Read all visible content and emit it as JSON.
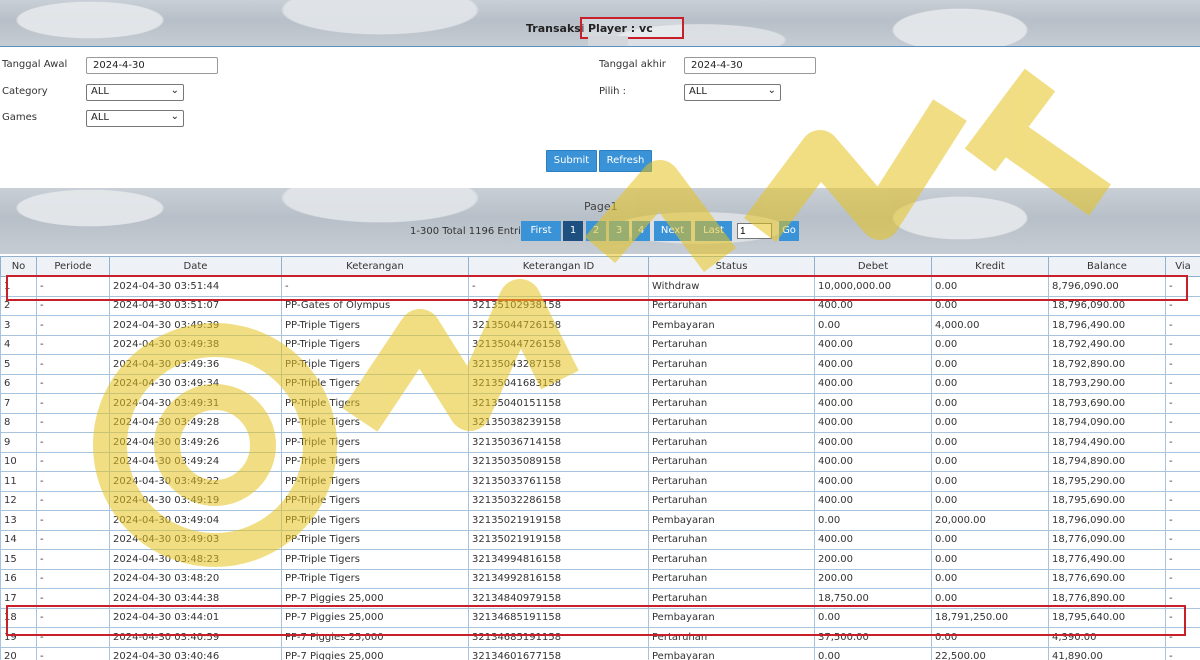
{
  "header": {
    "title": "Transaksi",
    "player_label": "Player : vc"
  },
  "filters": {
    "start_label": "Tanggal Awal",
    "start_value": "2024-4-30",
    "end_label": "Tanggal akhir",
    "end_value": "2024-4-30",
    "category_label": "Category",
    "category_value": "ALL",
    "pilih_label": "Pilih  :",
    "pilih_value": "ALL",
    "games_label": "Games",
    "games_value": "ALL",
    "submit": "Submit",
    "refresh": "Refresh"
  },
  "pagination": {
    "page_label": "Page1",
    "total": "1-300 Total 1196 Entri",
    "first": "First",
    "p1": "1",
    "p2": "2",
    "p3": "3",
    "p4": "4",
    "next": "Next",
    "last": "Last",
    "input_value": "1",
    "go": "Go"
  },
  "table": {
    "columns": [
      "No",
      "Periode",
      "Date",
      "Keterangan",
      "Keterangan ID",
      "Status",
      "Debet",
      "Kredit",
      "Balance",
      "Via"
    ],
    "rows": [
      [
        "1",
        "-",
        "2024-04-30 03:51:44",
        "-",
        "-",
        "Withdraw",
        "10,000,000.00",
        "0.00",
        "8,796,090.00",
        "-"
      ],
      [
        "2",
        "-",
        "2024-04-30 03:51:07",
        "PP-Gates of Olympus",
        "32135102938158",
        "Pertaruhan",
        "400.00",
        "0.00",
        "18,796,090.00",
        "-"
      ],
      [
        "3",
        "-",
        "2024-04-30 03:49:39",
        "PP-Triple Tigers",
        "32135044726158",
        "Pembayaran",
        "0.00",
        "4,000.00",
        "18,796,490.00",
        "-"
      ],
      [
        "4",
        "-",
        "2024-04-30 03:49:38",
        "PP-Triple Tigers",
        "32135044726158",
        "Pertaruhan",
        "400.00",
        "0.00",
        "18,792,490.00",
        "-"
      ],
      [
        "5",
        "-",
        "2024-04-30 03:49:36",
        "PP-Triple Tigers",
        "32135043287158",
        "Pertaruhan",
        "400.00",
        "0.00",
        "18,792,890.00",
        "-"
      ],
      [
        "6",
        "-",
        "2024-04-30 03:49:34",
        "PP-Triple Tigers",
        "32135041683158",
        "Pertaruhan",
        "400.00",
        "0.00",
        "18,793,290.00",
        "-"
      ],
      [
        "7",
        "-",
        "2024-04-30 03:49:31",
        "PP-Triple Tigers",
        "32135040151158",
        "Pertaruhan",
        "400.00",
        "0.00",
        "18,793,690.00",
        "-"
      ],
      [
        "8",
        "-",
        "2024-04-30 03:49:28",
        "PP-Triple Tigers",
        "32135038239158",
        "Pertaruhan",
        "400.00",
        "0.00",
        "18,794,090.00",
        "-"
      ],
      [
        "9",
        "-",
        "2024-04-30 03:49:26",
        "PP-Triple Tigers",
        "32135036714158",
        "Pertaruhan",
        "400.00",
        "0.00",
        "18,794,490.00",
        "-"
      ],
      [
        "10",
        "-",
        "2024-04-30 03:49:24",
        "PP-Triple Tigers",
        "32135035089158",
        "Pertaruhan",
        "400.00",
        "0.00",
        "18,794,890.00",
        "-"
      ],
      [
        "11",
        "-",
        "2024-04-30 03:49:22",
        "PP-Triple Tigers",
        "32135033761158",
        "Pertaruhan",
        "400.00",
        "0.00",
        "18,795,290.00",
        "-"
      ],
      [
        "12",
        "-",
        "2024-04-30 03:49:19",
        "PP-Triple Tigers",
        "32135032286158",
        "Pertaruhan",
        "400.00",
        "0.00",
        "18,795,690.00",
        "-"
      ],
      [
        "13",
        "-",
        "2024-04-30 03:49:04",
        "PP-Triple Tigers",
        "32135021919158",
        "Pembayaran",
        "0.00",
        "20,000.00",
        "18,796,090.00",
        "-"
      ],
      [
        "14",
        "-",
        "2024-04-30 03:49:03",
        "PP-Triple Tigers",
        "32135021919158",
        "Pertaruhan",
        "400.00",
        "0.00",
        "18,776,090.00",
        "-"
      ],
      [
        "15",
        "-",
        "2024-04-30 03:48:23",
        "PP-Triple Tigers",
        "32134994816158",
        "Pertaruhan",
        "200.00",
        "0.00",
        "18,776,490.00",
        "-"
      ],
      [
        "16",
        "-",
        "2024-04-30 03:48:20",
        "PP-Triple Tigers",
        "32134992816158",
        "Pertaruhan",
        "200.00",
        "0.00",
        "18,776,690.00",
        "-"
      ],
      [
        "17",
        "-",
        "2024-04-30 03:44:38",
        "PP-7 Piggies 25,000",
        "32134840979158",
        "Pertaruhan",
        "18,750.00",
        "0.00",
        "18,776,890.00",
        "-"
      ],
      [
        "18",
        "-",
        "2024-04-30 03:44:01",
        "PP-7 Piggies 25,000",
        "32134685191158",
        "Pembayaran",
        "0.00",
        "18,791,250.00",
        "18,795,640.00",
        "-"
      ],
      [
        "19",
        "-",
        "2024-04-30 03:40:59",
        "PP-7 Piggies 25,000",
        "32134685191158",
        "Pertaruhan",
        "37,500.00",
        "0.00",
        "4,390.00",
        "-"
      ],
      [
        "20",
        "-",
        "2024-04-30 03:40:46",
        "PP-7 Piggies 25,000",
        "32134601677158",
        "Pembayaran",
        "0.00",
        "22,500.00",
        "41,890.00",
        "-"
      ]
    ]
  },
  "colors": {
    "accent": "#3a93d6",
    "highlight": "#c8202a",
    "watermark": "#e6c21e"
  }
}
